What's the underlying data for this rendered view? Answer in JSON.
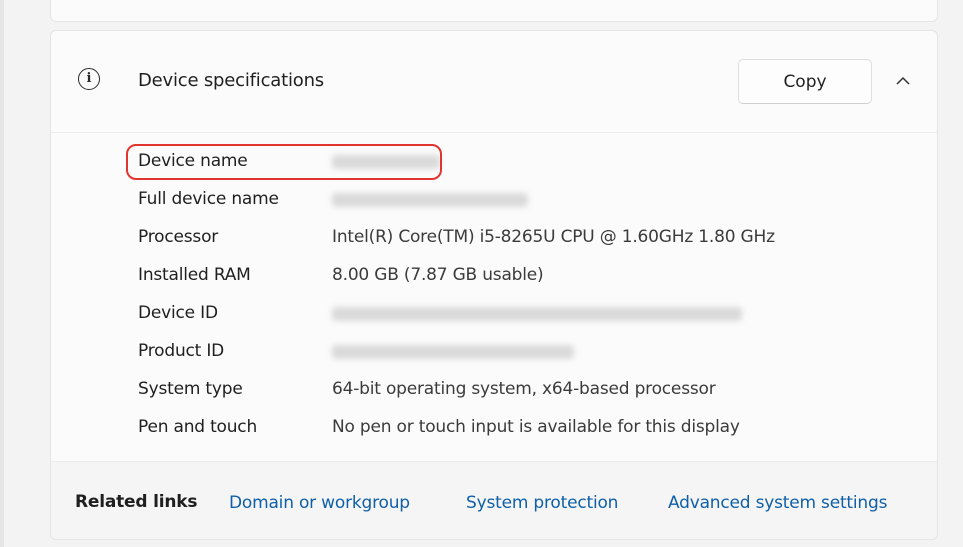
{
  "header": {
    "title": "Device specifications",
    "copy_label": "Copy",
    "info_icon_glyph": "i"
  },
  "specs": [
    {
      "label": "Device name",
      "value": "",
      "redacted": true
    },
    {
      "label": "Full device name",
      "value": "",
      "redacted": true
    },
    {
      "label": "Processor",
      "value": "Intel(R) Core(TM) i5-8265U CPU @ 1.60GHz   1.80 GHz",
      "redacted": false
    },
    {
      "label": "Installed RAM",
      "value": "8.00 GB (7.87 GB usable)",
      "redacted": false
    },
    {
      "label": "Device ID",
      "value": "",
      "redacted": true
    },
    {
      "label": "Product ID",
      "value": "",
      "redacted": true
    },
    {
      "label": "System type",
      "value": "64-bit operating system, x64-based processor",
      "redacted": false
    },
    {
      "label": "Pen and touch",
      "value": "No pen or touch input is available for this display",
      "redacted": false
    }
  ],
  "related_links": {
    "title": "Related links",
    "links": [
      "Domain or workgroup",
      "System protection",
      "Advanced system settings"
    ]
  },
  "icons": {
    "info": "info-icon",
    "collapse": "chevron-up-icon"
  },
  "colors": {
    "link": "#0f5fa8",
    "highlight": "#e2342f"
  }
}
